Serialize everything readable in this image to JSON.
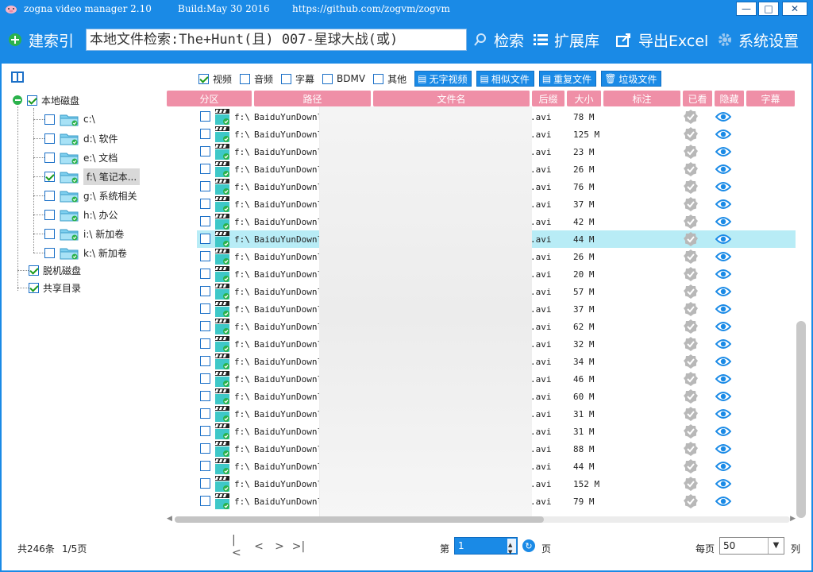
{
  "titlebar": {
    "app_name": "zogna video manager 2.10",
    "build": "Build:May 30 2016",
    "url": "https://github.com/zogvm/zogvm",
    "minimize": "—",
    "maximize": "□",
    "close": "✕"
  },
  "toolbar": {
    "build_index": "建索引",
    "search_value": "本地文件检索:The+Hunt(且) 007-星球大战(或)",
    "search": "检索",
    "library": "扩展库",
    "export": "导出Excel",
    "settings": "系统设置"
  },
  "tree": {
    "root": "本地磁盘",
    "drives": [
      {
        "label": "c:\\",
        "checked": false
      },
      {
        "label": "d:\\ 软件",
        "checked": false
      },
      {
        "label": "e:\\ 文档",
        "checked": false
      },
      {
        "label": "f:\\ 笔记本...",
        "checked": true
      },
      {
        "label": "g:\\ 系统相关",
        "checked": false
      },
      {
        "label": "h:\\ 办公",
        "checked": false
      },
      {
        "label": "i:\\ 新加卷",
        "checked": false
      },
      {
        "label": "k:\\ 新加卷",
        "checked": false
      }
    ],
    "offline": "脱机磁盘",
    "shared": "共享目录"
  },
  "filters": {
    "video": "视频",
    "audio": "音频",
    "subtitle": "字幕",
    "bdmv": "BDMV",
    "other": "其他",
    "no_subtitle_video": "无字视频",
    "similar_files": "相似文件",
    "duplicate_files": "重复文件",
    "junk_files": "垃圾文件"
  },
  "grid": {
    "headers": [
      "分区",
      "路径",
      "文件名",
      "后缀",
      "大小",
      "标注",
      "已看",
      "隐藏",
      "字幕"
    ],
    "rows": [
      {
        "drive": "f:\\",
        "path": "BaiduYunDownload",
        "ext": ".avi",
        "size": "78 M"
      },
      {
        "drive": "f:\\",
        "path": "BaiduYunDownload",
        "ext": ".avi",
        "size": "125 M"
      },
      {
        "drive": "f:\\",
        "path": "BaiduYunDownload",
        "ext": ".avi",
        "size": "23 M"
      },
      {
        "drive": "f:\\",
        "path": "BaiduYunDownload",
        "ext": ".avi",
        "size": "26 M"
      },
      {
        "drive": "f:\\",
        "path": "BaiduYunDownload",
        "ext": ".avi",
        "size": "76 M"
      },
      {
        "drive": "f:\\",
        "path": "BaiduYunDownload",
        "ext": ".avi",
        "size": "37 M"
      },
      {
        "drive": "f:\\",
        "path": "BaiduYunDownload",
        "ext": ".avi",
        "size": "42 M"
      },
      {
        "drive": "f:\\",
        "path": "BaiduYunDownload",
        "ext": ".avi",
        "size": "44 M"
      },
      {
        "drive": "f:\\",
        "path": "BaiduYunDownload",
        "ext": ".avi",
        "size": "26 M"
      },
      {
        "drive": "f:\\",
        "path": "BaiduYunDownload",
        "ext": ".avi",
        "size": "20 M"
      },
      {
        "drive": "f:\\",
        "path": "BaiduYunDownload",
        "ext": ".avi",
        "size": "57 M"
      },
      {
        "drive": "f:\\",
        "path": "BaiduYunDownload",
        "ext": ".avi",
        "size": "37 M"
      },
      {
        "drive": "f:\\",
        "path": "BaiduYunDownload",
        "ext": ".avi",
        "size": "62 M"
      },
      {
        "drive": "f:\\",
        "path": "BaiduYunDownload",
        "ext": ".avi",
        "size": "32 M"
      },
      {
        "drive": "f:\\",
        "path": "BaiduYunDownload",
        "ext": ".avi",
        "size": "34 M"
      },
      {
        "drive": "f:\\",
        "path": "BaiduYunDownload",
        "ext": ".avi",
        "size": "46 M"
      },
      {
        "drive": "f:\\",
        "path": "BaiduYunDownload",
        "ext": ".avi",
        "size": "60 M"
      },
      {
        "drive": "f:\\",
        "path": "BaiduYunDownload",
        "ext": ".avi",
        "size": "31 M"
      },
      {
        "drive": "f:\\",
        "path": "BaiduYunDownload",
        "ext": ".avi",
        "size": "31 M"
      },
      {
        "drive": "f:\\",
        "path": "BaiduYunDownload",
        "ext": ".avi",
        "size": "88 M"
      },
      {
        "drive": "f:\\",
        "path": "BaiduYunDownload",
        "ext": ".avi",
        "size": "44 M"
      },
      {
        "drive": "f:\\",
        "path": "BaiduYunDownload",
        "ext": ".avi",
        "size": "152 M"
      },
      {
        "drive": "f:\\",
        "path": "BaiduYunDownload",
        "ext": ".avi",
        "size": "79 M"
      }
    ],
    "highlighted_row": 7
  },
  "footer": {
    "total": "共246条",
    "pages": "1/5页",
    "page_prefix": "第",
    "page_value": "1",
    "page_suffix": "页",
    "per_page_prefix": "每页",
    "per_page_value": "50",
    "per_page_suffix": "列"
  },
  "colors": {
    "accent": "#1a8ae6",
    "header_pink": "#ef8fa7",
    "highlight": "#b8ecf6"
  }
}
